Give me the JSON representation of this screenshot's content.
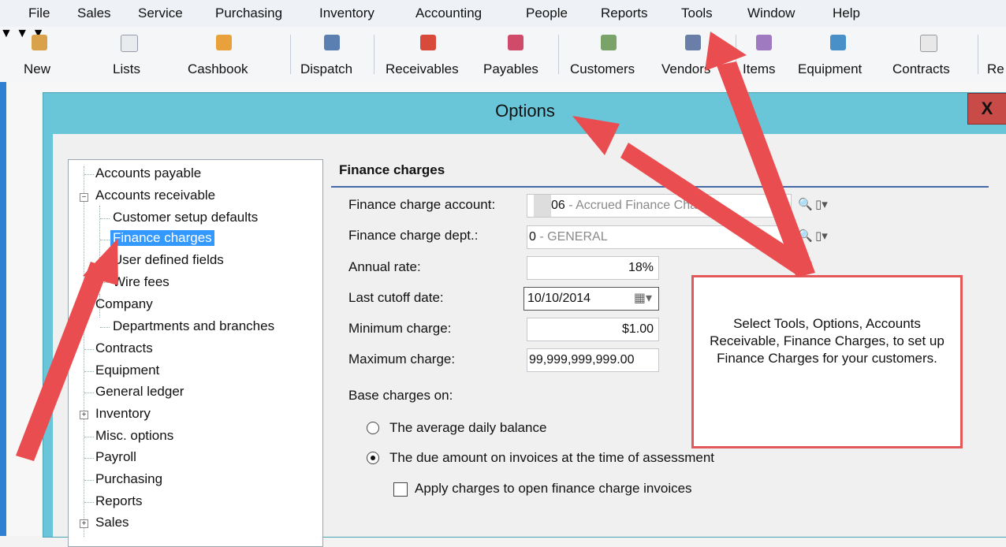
{
  "menubar": {
    "items": [
      "File",
      "Sales",
      "Service",
      "Purchasing",
      "Inventory",
      "Accounting",
      "People",
      "Reports",
      "Tools",
      "Window",
      "Help"
    ]
  },
  "toolbar": {
    "buttons": [
      {
        "label": "New",
        "icon": "new-icon"
      },
      {
        "label": "Lists",
        "icon": "lists-icon"
      },
      {
        "label": "Cashbook",
        "icon": "cashbook-icon"
      },
      {
        "label": "Dispatch",
        "icon": "dispatch-icon"
      },
      {
        "label": "Receivables",
        "icon": "receivables-icon"
      },
      {
        "label": "Payables",
        "icon": "payables-icon"
      },
      {
        "label": "Customers",
        "icon": "customers-icon"
      },
      {
        "label": "Vendors",
        "icon": "vendors-icon"
      },
      {
        "label": "Items",
        "icon": "items-icon"
      },
      {
        "label": "Equipment",
        "icon": "equipment-icon"
      },
      {
        "label": "Contracts",
        "icon": "contracts-icon"
      },
      {
        "label": "Re",
        "icon": "reports-icon"
      }
    ]
  },
  "dialog": {
    "title": "Options",
    "close_label": "X"
  },
  "tree": {
    "items": [
      "Accounts payable",
      "Accounts receivable",
      "Customer setup defaults",
      "Finance charges",
      "User defined fields",
      "Wire fees",
      "Company",
      "Departments and branches",
      "Contracts",
      "Equipment",
      "General ledger",
      "Inventory",
      "Misc. options",
      "Payroll",
      "Purchasing",
      "Reports",
      "Sales"
    ]
  },
  "form": {
    "header": "Finance charges",
    "account_label": "Finance charge account:",
    "account_code": "06",
    "account_name": " - Accrued Finance Charges",
    "dept_label": "Finance charge dept.:",
    "dept_code": "0",
    "dept_name": " - GENERAL",
    "annual_rate_label": "Annual rate:",
    "annual_rate_value": "18%",
    "cutoff_label": "Last cutoff date:",
    "cutoff_value": "10/10/2014",
    "min_label": "Minimum charge:",
    "min_value": "$1.00",
    "max_label": "Maximum charge:",
    "max_value": "99,999,999,999.00",
    "base_label": "Base charges on:",
    "option_avg": "The average daily balance",
    "option_due": "The due amount on invoices at the time of assessment",
    "apply_label": "Apply charges to open finance charge invoices"
  },
  "callout": {
    "text": "Select Tools, Options, Accounts Receivable, Finance Charges, to set up Finance Charges for your customers."
  },
  "colors": {
    "dialog_title_bar": "#68c6d8",
    "close_button": "#c84b48",
    "selection": "#3399ff",
    "arrow": "#ea4d4f",
    "callout_border": "#e35858"
  }
}
